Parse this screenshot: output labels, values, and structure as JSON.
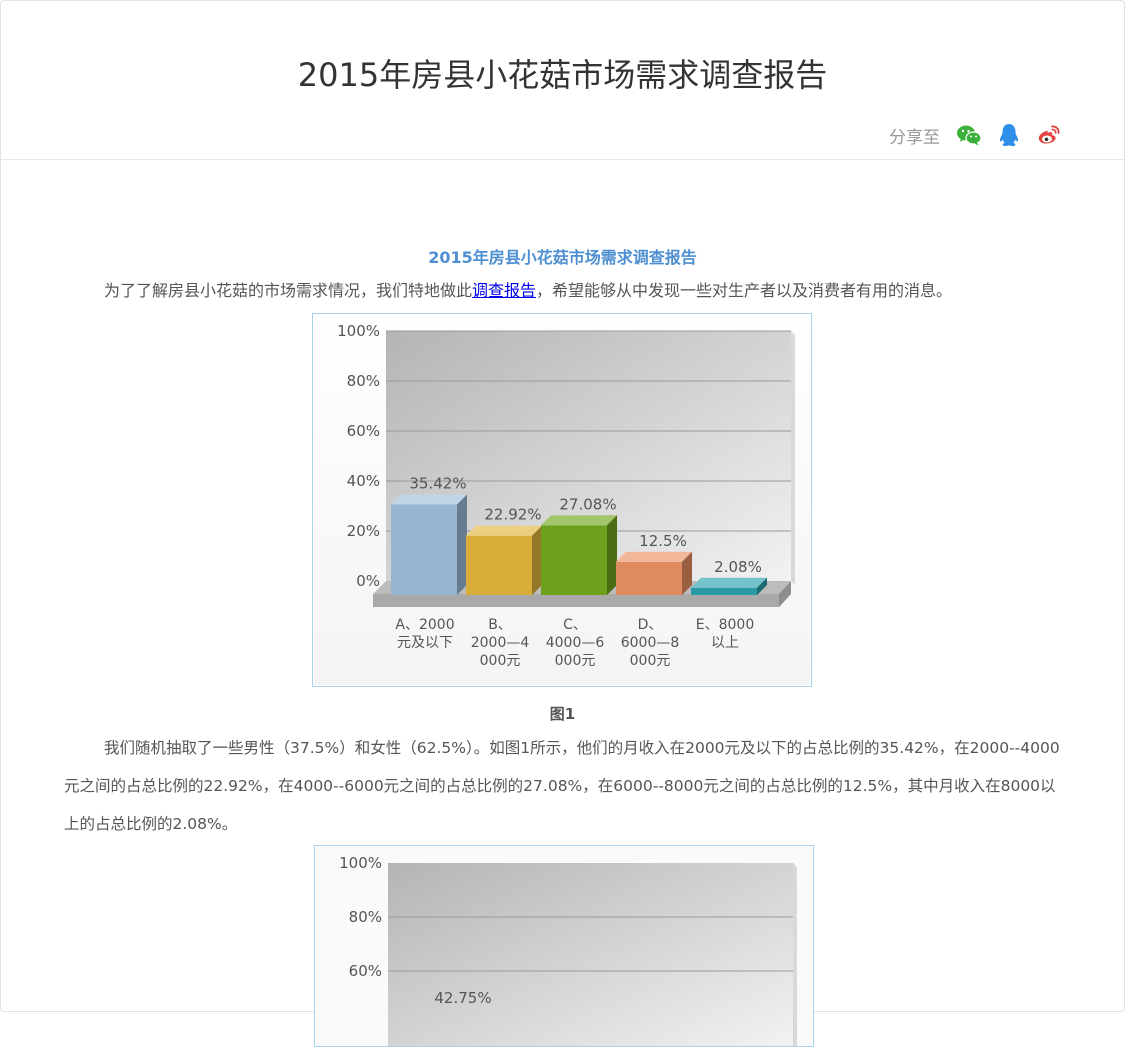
{
  "header": {
    "title": "2015年房县小花菇市场需求调查报告",
    "share_label": "分享至",
    "share_icons": [
      "wechat-icon",
      "qq-icon",
      "weibo-icon"
    ]
  },
  "article": {
    "subtitle": "2015年房县小花菇市场需求调查报告",
    "intro_before": "为了了解房县小花菇的市场需求情况，我们特地做此",
    "intro_link": "调查报告",
    "intro_after": "，希望能够从中发现一些对生产者以及消费者有用的消息。",
    "figure1_caption": "图1",
    "paragraph1": "我们随机抽取了一些男性（37.5%）和女性（62.5%）。如图1所示，他们的月收入在2000元及以下的占总比例的35.42%，在2000--4000元之间的占总比例的22.92%，在4000--6000元之间的占总比例的27.08%，在6000--8000元之间的占总比例的12.5%，其中月收入在8000以上的占总比例的2.08%。"
  },
  "colors": {
    "title": "#333333",
    "subtitle": "#4e8fd1",
    "chart_border": "#a9d2ec",
    "wechat": "#3bb03a",
    "qq": "#2e8fea",
    "weibo": "#e2433e"
  },
  "chart_data": [
    {
      "type": "bar",
      "style": "3d",
      "categories": [
        "A、2000元及以下",
        "B、2000—4000元",
        "C、4000—6000元",
        "D、6000—8000元",
        "E、8000以上"
      ],
      "category_lines": [
        [
          "A、2000",
          "元及以下"
        ],
        [
          "B、",
          "2000—4",
          "000元"
        ],
        [
          "C、",
          "4000—6",
          "000元"
        ],
        [
          "D、",
          "6000—8",
          "000元"
        ],
        [
          "E、8000",
          "以上"
        ]
      ],
      "values": [
        35.42,
        22.92,
        27.08,
        12.5,
        2.08
      ],
      "value_labels": [
        "35.42%",
        "22.92%",
        "27.08%",
        "12.5%",
        "2.08%"
      ],
      "bar_colors": [
        "#9fbfdd",
        "#e2b53a",
        "#72a81f",
        "#ec9264",
        "#2aa3ad"
      ],
      "ylim": [
        0,
        100
      ],
      "yticks": [
        "0%",
        "20%",
        "40%",
        "60%",
        "80%",
        "100%"
      ],
      "grid": true
    },
    {
      "type": "bar",
      "style": "3d",
      "categories": [],
      "value_labels": [
        "42.75%"
      ],
      "ylim": [
        0,
        100
      ],
      "yticks": [
        "60%",
        "80%",
        "100%"
      ],
      "grid": true
    }
  ]
}
